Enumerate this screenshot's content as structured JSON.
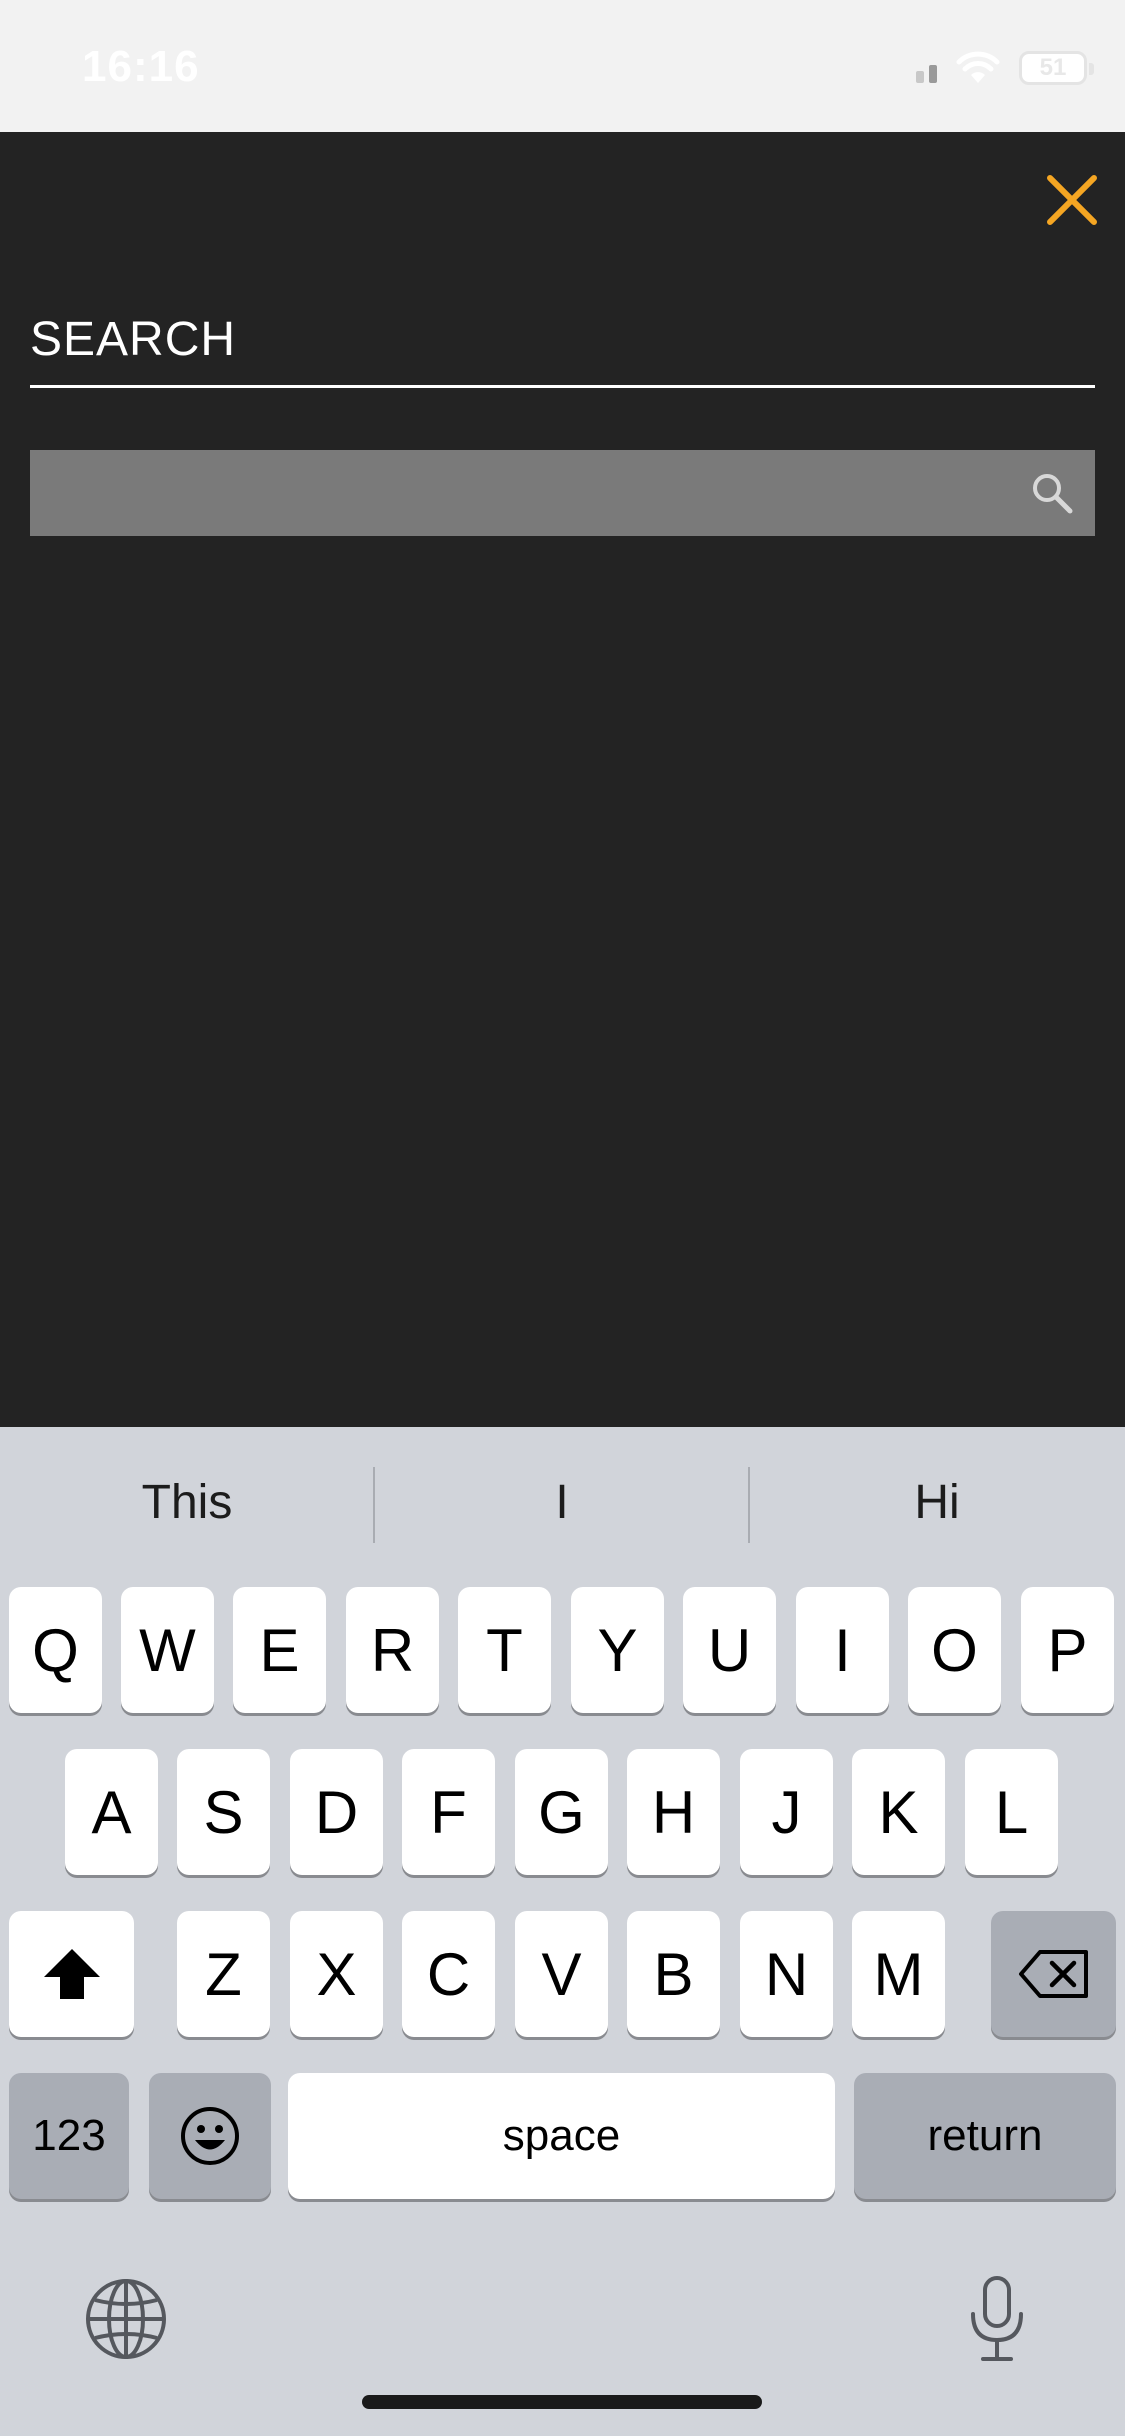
{
  "status_bar": {
    "time": "16:16",
    "battery": "51"
  },
  "header": {
    "title": "SEARCH"
  },
  "search": {
    "value": "",
    "placeholder": ""
  },
  "colors": {
    "accent": "#F5A623",
    "overlay": "#232323",
    "search_box": "#7A7A7A"
  },
  "icons": {
    "close": "close-icon",
    "search": "search-icon",
    "shift": "shift-icon",
    "delete": "delete-icon",
    "emoji": "emoji-icon",
    "globe": "globe-icon",
    "mic": "microphone-icon"
  },
  "keyboard": {
    "suggestions": [
      "This",
      "I",
      "Hi"
    ],
    "row1": [
      "Q",
      "W",
      "E",
      "R",
      "T",
      "Y",
      "U",
      "I",
      "O",
      "P"
    ],
    "row2": [
      "A",
      "S",
      "D",
      "F",
      "G",
      "H",
      "J",
      "K",
      "L"
    ],
    "row3": [
      "Z",
      "X",
      "C",
      "V",
      "B",
      "N",
      "M"
    ],
    "numbers_label": "123",
    "space_label": "space",
    "return_label": "return"
  }
}
